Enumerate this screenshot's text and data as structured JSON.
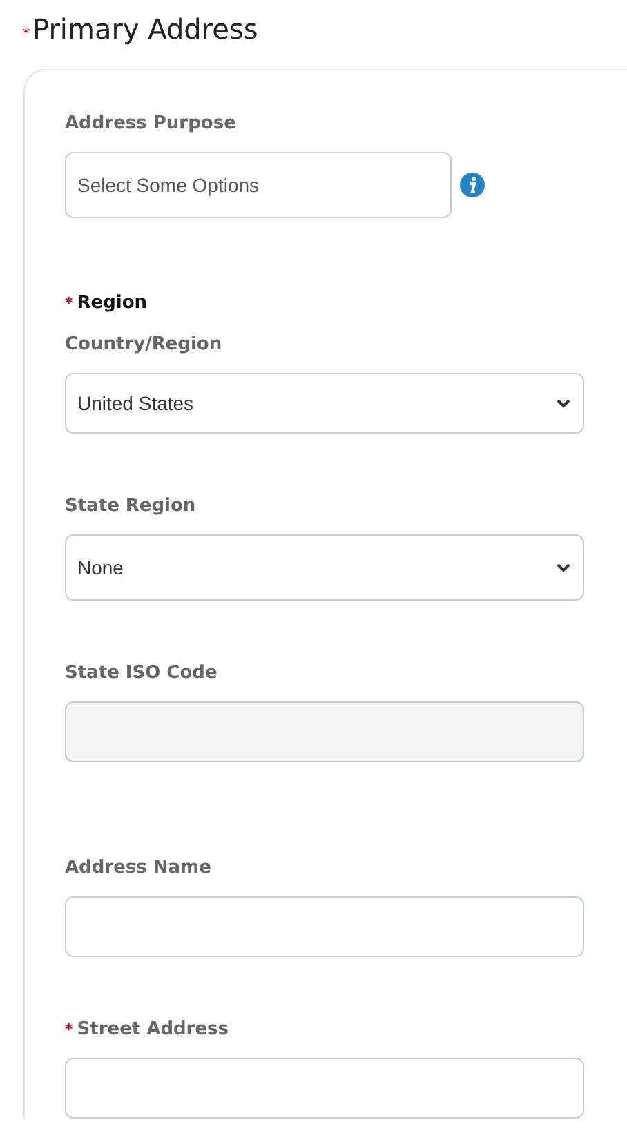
{
  "section": {
    "title": "Primary Address",
    "required_mark": "*"
  },
  "fields": [
    {
      "kind": "multiselect",
      "label": "Address Purpose",
      "placeholder": "Select Some Options",
      "info": true
    },
    {
      "kind": "heading",
      "label": "Region",
      "required_mark": "*"
    },
    {
      "kind": "select",
      "label": "Country/Region",
      "value": "United States"
    },
    {
      "kind": "select",
      "label": "State Region",
      "value": "None"
    },
    {
      "kind": "readonly",
      "label": "State ISO Code"
    },
    {
      "kind": "text",
      "label": "Address Name"
    },
    {
      "kind": "text",
      "label": "Street Address",
      "required_mark": "*"
    }
  ]
}
